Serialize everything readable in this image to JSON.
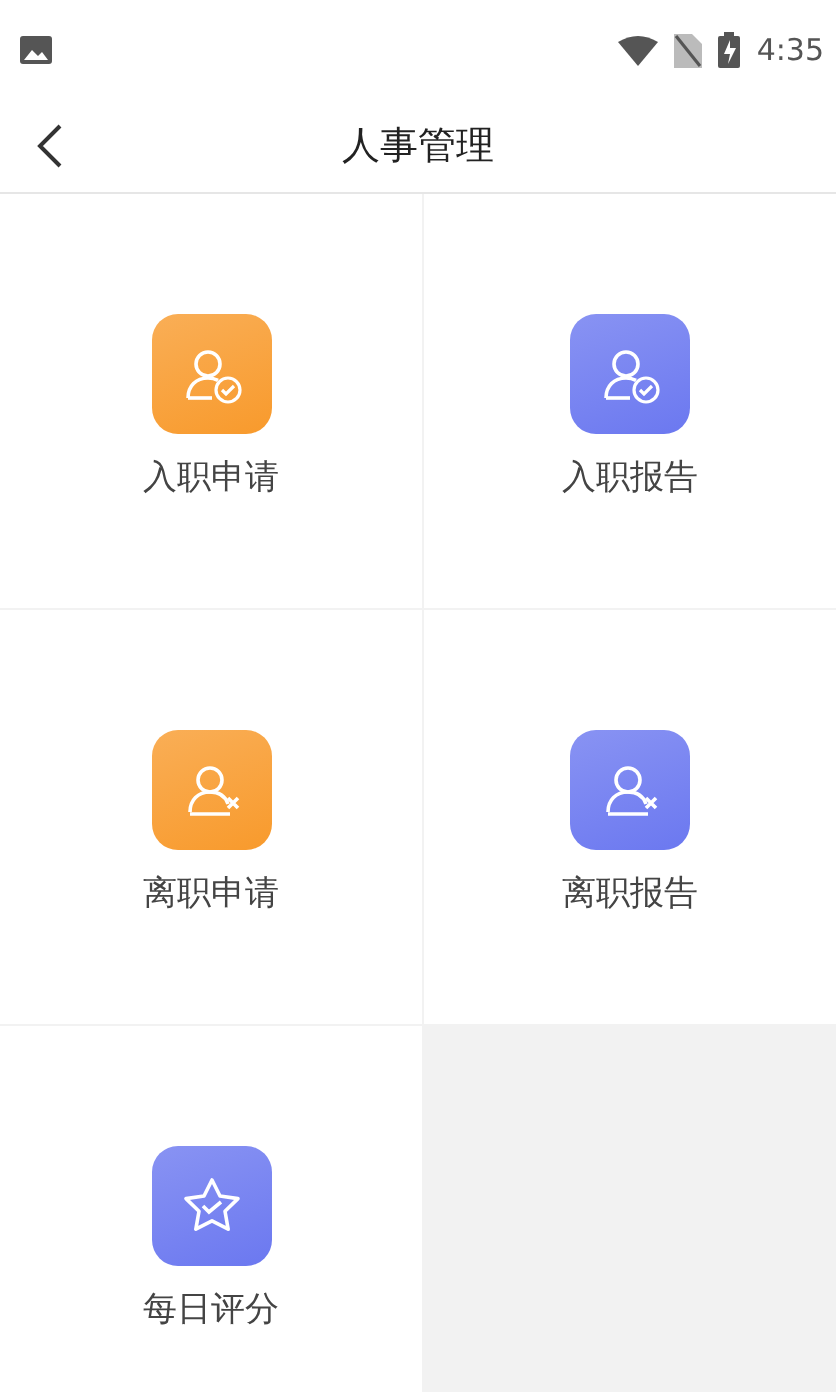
{
  "status_bar": {
    "time": "4:35"
  },
  "header": {
    "title": "人事管理"
  },
  "tiles": [
    {
      "label": "入职申请",
      "kind": "person-check",
      "color": "#f89a2c"
    },
    {
      "label": "入职报告",
      "kind": "person-check",
      "color": "#6b78f0"
    },
    {
      "label": "离职申请",
      "kind": "person-cross",
      "color": "#f89a2c"
    },
    {
      "label": "离职报告",
      "kind": "person-cross",
      "color": "#6b78f0"
    },
    {
      "label": "每日评分",
      "kind": "star-check",
      "color": "#6b78f0"
    }
  ]
}
